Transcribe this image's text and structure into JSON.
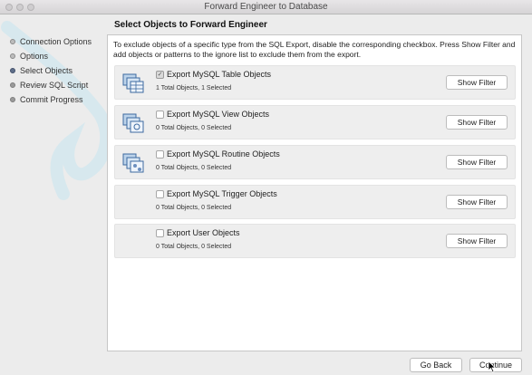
{
  "window": {
    "title": "Forward Engineer to Database"
  },
  "sidebar": {
    "steps": [
      {
        "label": "Connection Options",
        "state": "done"
      },
      {
        "label": "Options",
        "state": "done"
      },
      {
        "label": "Select Objects",
        "state": "current"
      },
      {
        "label": "Review SQL Script",
        "state": "pending"
      },
      {
        "label": "Commit Progress",
        "state": "pending"
      }
    ]
  },
  "main": {
    "heading": "Select Objects to Forward Engineer",
    "description": "To exclude objects of a specific type from the SQL Export, disable the corresponding checkbox. Press Show Filter and add objects or patterns to the ignore list to exclude them from the export.",
    "objects": [
      {
        "label": "Export MySQL Table Objects",
        "checked": true,
        "count": "1 Total Objects, 1 Selected",
        "button": "Show Filter",
        "icon": "table-objects-icon"
      },
      {
        "label": "Export MySQL View Objects",
        "checked": false,
        "count": "0 Total Objects, 0 Selected",
        "button": "Show Filter",
        "icon": "view-objects-icon"
      },
      {
        "label": "Export MySQL Routine Objects",
        "checked": false,
        "count": "0 Total Objects, 0 Selected",
        "button": "Show Filter",
        "icon": "routine-objects-icon"
      },
      {
        "label": "Export MySQL Trigger Objects",
        "checked": false,
        "count": "0 Total Objects, 0 Selected",
        "button": "Show Filter",
        "icon": ""
      },
      {
        "label": "Export User Objects",
        "checked": false,
        "count": "0 Total Objects, 0 Selected",
        "button": "Show Filter",
        "icon": ""
      }
    ]
  },
  "footer": {
    "back_label": "Go Back",
    "continue_label": "Continue"
  },
  "colors": {
    "current_step": "#5f6f8a",
    "panel_bg": "#ffffff",
    "window_bg": "#ececec",
    "swoosh": "#c9e2ec"
  }
}
